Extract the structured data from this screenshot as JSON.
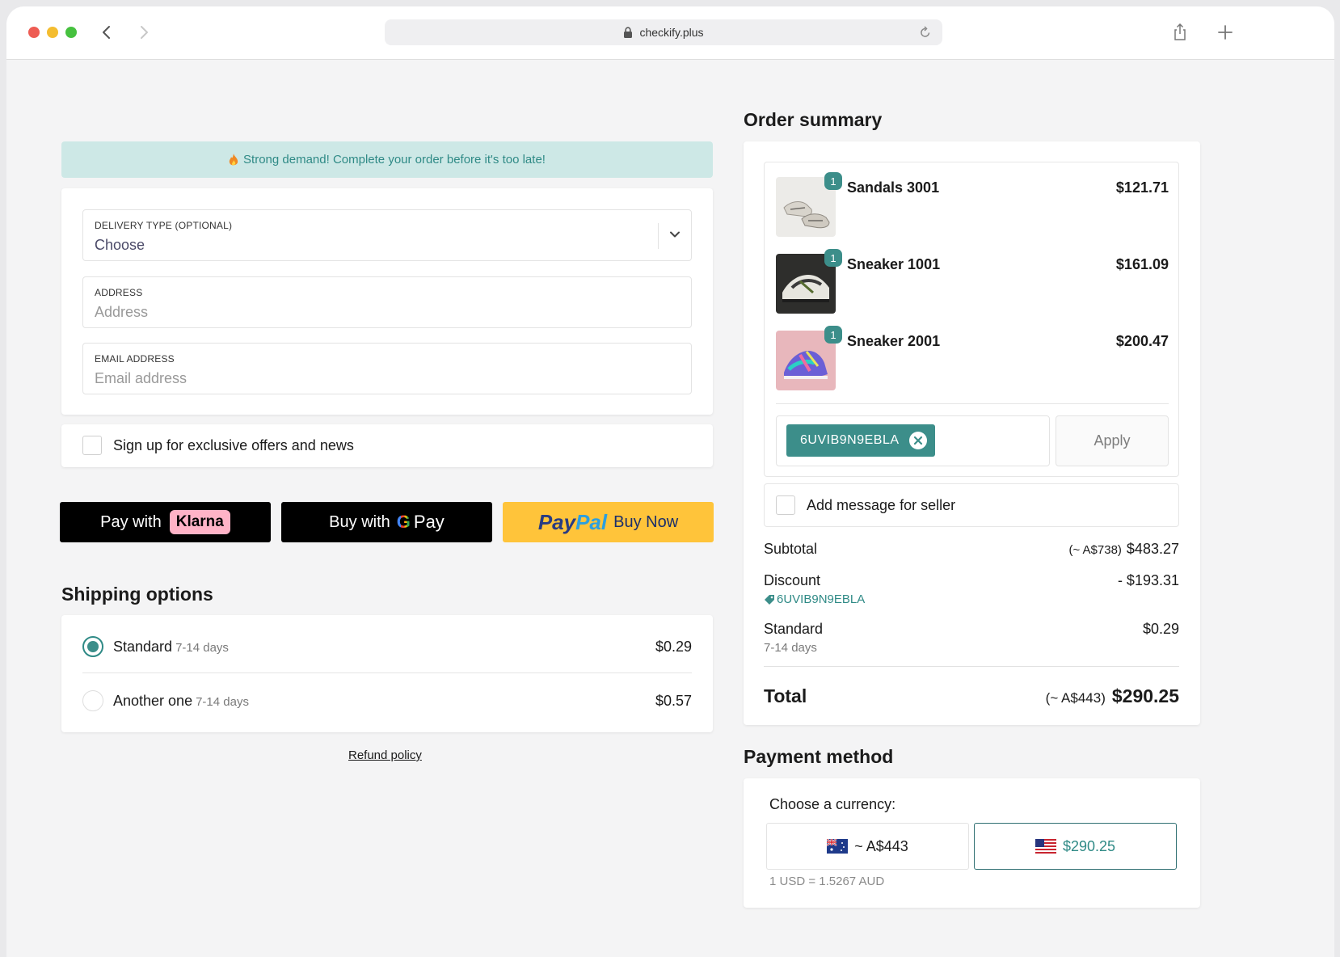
{
  "browser": {
    "url": "checkify.plus"
  },
  "banner": {
    "text": "Strong demand! Complete your order before it's too late!"
  },
  "form": {
    "delivery": {
      "label": "DELIVERY TYPE (OPTIONAL)",
      "value": "Choose"
    },
    "address": {
      "label": "ADDRESS",
      "placeholder": "Address"
    },
    "email": {
      "label": "EMAIL ADDRESS",
      "placeholder": "Email address"
    },
    "signup_label": "Sign up for exclusive offers and news"
  },
  "express_pay": {
    "klarna_prefix": "Pay with",
    "klarna_brand": "Klarna",
    "gpay_prefix": "Buy with",
    "gpay_g": "G",
    "gpay_pay": "Pay",
    "paypal_pay": "Pay",
    "paypal_pal": "Pal",
    "paypal_suffix": "Buy Now"
  },
  "shipping": {
    "title": "Shipping options",
    "options": [
      {
        "name": "Standard",
        "days": "7-14 days",
        "price": "$0.29",
        "selected": true
      },
      {
        "name": "Another one",
        "days": "7-14 days",
        "price": "$0.57",
        "selected": false
      }
    ],
    "refund_link": "Refund policy"
  },
  "order_summary": {
    "title": "Order summary",
    "items": [
      {
        "name": "Sandals 3001",
        "price": "$121.71",
        "qty": "1"
      },
      {
        "name": "Sneaker 1001",
        "price": "$161.09",
        "qty": "1"
      },
      {
        "name": "Sneaker 2001",
        "price": "$200.47",
        "qty": "1"
      }
    ],
    "coupon_code": "6UVIB9N9EBLA",
    "apply_label": "Apply",
    "message_label": "Add message for seller",
    "subtotal": {
      "label": "Subtotal",
      "converted": "(~ A$738)",
      "value": "$483.27"
    },
    "discount": {
      "label": "Discount",
      "code": "6UVIB9N9EBLA",
      "value": "- $193.31"
    },
    "shipping": {
      "label": "Standard",
      "days": "7-14 days",
      "value": "$0.29"
    },
    "total": {
      "label": "Total",
      "converted": "(~ A$443)",
      "value": "$290.25"
    }
  },
  "payment": {
    "title": "Payment method",
    "currency_label": "Choose a currency:",
    "aud_option": "~ A$443",
    "usd_option": "$290.25",
    "rate": "1 USD = 1.5267 AUD"
  },
  "colors": {
    "accent": "#3c8e8a",
    "banner_bg": "#cde8e6",
    "paypal_yellow": "#ffc43a"
  }
}
